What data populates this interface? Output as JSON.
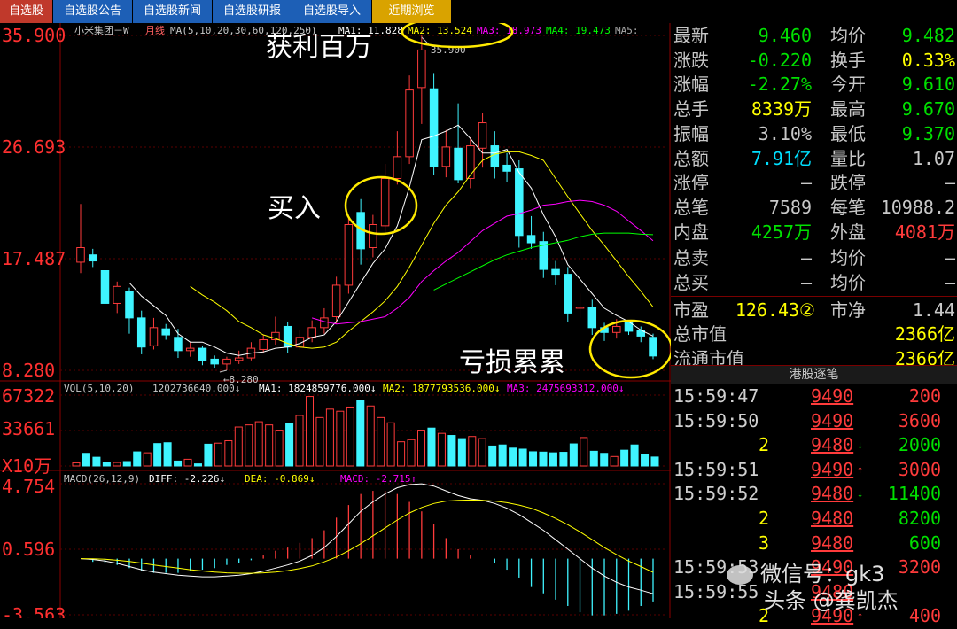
{
  "tabs": [
    "自选股",
    "自选股公告",
    "自选股新闻",
    "自选股研报",
    "自选股导入",
    "近期浏览"
  ],
  "chart_data": {
    "type": "candlestick",
    "title": "小米集团－W",
    "period": "月线",
    "ma_legend": "MA(5,10,20,30,60,120,250)",
    "ma_items": [
      {
        "text": "MA1: 11.828",
        "color": "#ffffff"
      },
      {
        "text": "MA2: 13.524",
        "color": "#ffff00"
      },
      {
        "text": "MA3: 18.973",
        "color": "#ff00ff"
      },
      {
        "text": "MA4: 19.473",
        "color": "#00ff00"
      },
      {
        "text": "MA5:",
        "color": "#aaaaaa"
      }
    ],
    "price_ticks": [
      "35.900",
      "26.693",
      "17.487",
      "8.280"
    ],
    "price_tick_values": [
      35.9,
      26.693,
      17.487,
      8.28
    ],
    "ylim": [
      8.28,
      35.9
    ],
    "high_label": "35.900",
    "low_label": "8.280",
    "candles": [
      {
        "o": 17.2,
        "h": 22.0,
        "l": 16.3,
        "c": 18.4
      },
      {
        "o": 17.8,
        "h": 18.3,
        "l": 16.8,
        "c": 17.3
      },
      {
        "o": 16.5,
        "h": 16.9,
        "l": 13.2,
        "c": 13.8
      },
      {
        "o": 13.8,
        "h": 15.6,
        "l": 13.0,
        "c": 15.2
      },
      {
        "o": 14.8,
        "h": 15.1,
        "l": 11.3,
        "c": 12.6
      },
      {
        "o": 12.6,
        "h": 13.2,
        "l": 9.6,
        "c": 10.2
      },
      {
        "o": 10.3,
        "h": 12.6,
        "l": 10.0,
        "c": 11.8
      },
      {
        "o": 11.7,
        "h": 12.1,
        "l": 10.8,
        "c": 11.2
      },
      {
        "o": 11.0,
        "h": 11.7,
        "l": 9.3,
        "c": 9.9
      },
      {
        "o": 9.9,
        "h": 10.6,
        "l": 9.4,
        "c": 10.1
      },
      {
        "o": 10.1,
        "h": 10.3,
        "l": 8.7,
        "c": 9.1
      },
      {
        "o": 9.2,
        "h": 9.5,
        "l": 8.5,
        "c": 8.8
      },
      {
        "o": 8.8,
        "h": 9.4,
        "l": 8.28,
        "c": 9.2
      },
      {
        "o": 9.1,
        "h": 9.9,
        "l": 8.8,
        "c": 9.3
      },
      {
        "o": 9.3,
        "h": 10.6,
        "l": 9.1,
        "c": 10.1
      },
      {
        "o": 10.0,
        "h": 11.2,
        "l": 9.7,
        "c": 10.8
      },
      {
        "o": 10.8,
        "h": 12.7,
        "l": 10.4,
        "c": 11.4
      },
      {
        "o": 11.9,
        "h": 12.3,
        "l": 9.7,
        "c": 10.2
      },
      {
        "o": 10.2,
        "h": 11.6,
        "l": 10.0,
        "c": 11.0
      },
      {
        "o": 11.0,
        "h": 12.4,
        "l": 10.6,
        "c": 11.8
      },
      {
        "o": 11.8,
        "h": 13.4,
        "l": 11.3,
        "c": 12.6
      },
      {
        "o": 12.7,
        "h": 16.0,
        "l": 12.1,
        "c": 15.3
      },
      {
        "o": 15.3,
        "h": 21.0,
        "l": 14.6,
        "c": 20.3
      },
      {
        "o": 21.3,
        "h": 22.4,
        "l": 17.0,
        "c": 18.3
      },
      {
        "o": 18.4,
        "h": 21.1,
        "l": 17.6,
        "c": 20.3
      },
      {
        "o": 20.2,
        "h": 25.3,
        "l": 19.7,
        "c": 24.1
      },
      {
        "o": 24.1,
        "h": 28.0,
        "l": 23.6,
        "c": 25.9
      },
      {
        "o": 25.9,
        "h": 32.6,
        "l": 25.3,
        "c": 31.4
      },
      {
        "o": 31.6,
        "h": 35.9,
        "l": 28.6,
        "c": 34.7
      },
      {
        "o": 31.5,
        "h": 32.8,
        "l": 24.4,
        "c": 25.1
      },
      {
        "o": 25.1,
        "h": 28.1,
        "l": 24.2,
        "c": 26.7
      },
      {
        "o": 26.6,
        "h": 30.3,
        "l": 23.7,
        "c": 24.0
      },
      {
        "o": 24.1,
        "h": 27.5,
        "l": 23.3,
        "c": 26.8
      },
      {
        "o": 26.6,
        "h": 29.5,
        "l": 25.0,
        "c": 28.7
      },
      {
        "o": 26.8,
        "h": 28.0,
        "l": 24.1,
        "c": 25.1
      },
      {
        "o": 25.2,
        "h": 26.2,
        "l": 23.8,
        "c": 24.7
      },
      {
        "o": 24.9,
        "h": 25.6,
        "l": 18.4,
        "c": 19.4
      },
      {
        "o": 19.4,
        "h": 21.0,
        "l": 18.3,
        "c": 18.8
      },
      {
        "o": 18.9,
        "h": 19.7,
        "l": 15.9,
        "c": 16.6
      },
      {
        "o": 16.6,
        "h": 17.3,
        "l": 15.3,
        "c": 16.2
      },
      {
        "o": 16.2,
        "h": 16.8,
        "l": 12.3,
        "c": 13.0
      },
      {
        "o": 13.4,
        "h": 14.6,
        "l": 12.6,
        "c": 13.5
      },
      {
        "o": 13.5,
        "h": 14.1,
        "l": 11.2,
        "c": 11.8
      },
      {
        "o": 11.8,
        "h": 12.2,
        "l": 10.7,
        "c": 11.4
      },
      {
        "o": 11.4,
        "h": 12.5,
        "l": 10.9,
        "c": 11.9
      },
      {
        "o": 12.2,
        "h": 12.4,
        "l": 11.2,
        "c": 11.5
      },
      {
        "o": 11.6,
        "h": 11.9,
        "l": 10.6,
        "c": 11.1
      },
      {
        "o": 11.0,
        "h": 11.3,
        "l": 9.2,
        "c": 9.46
      }
    ],
    "ma_lines": [
      {
        "name": "MA1",
        "color": "#ffffff",
        "values": [
          null,
          null,
          null,
          null,
          15.5,
          14.4,
          13.6,
          12.8,
          11.3,
          10.6,
          10.6,
          10.2,
          9.7,
          9.5,
          9.7,
          9.8,
          10.1,
          10.2,
          10.5,
          11.0,
          11.2,
          12.3,
          13.9,
          15.5,
          17.1,
          18.3,
          20.2,
          23.4,
          27.3,
          27.6,
          28.0,
          28.5,
          27.4,
          26.2,
          26.2,
          26.5,
          24.6,
          23.3,
          21.1,
          19.3,
          17.0,
          15.8,
          14.6,
          13.4,
          12.8,
          12.3,
          11.6,
          11.1
        ]
      },
      {
        "name": "MA2",
        "color": "#ffff00",
        "values": [
          null,
          null,
          null,
          null,
          null,
          null,
          null,
          null,
          null,
          15.2,
          14.5,
          13.9,
          13.2,
          12.3,
          11.8,
          11.2,
          10.9,
          10.5,
          10.2,
          10.1,
          10.2,
          10.6,
          11.5,
          12.3,
          13.1,
          14.0,
          15.2,
          16.8,
          18.6,
          20.4,
          21.9,
          23.0,
          24.4,
          25.6,
          26.1,
          26.3,
          26.3,
          26.0,
          25.6,
          24.1,
          22.6,
          21.2,
          19.8,
          18.6,
          17.3,
          16.0,
          14.8,
          13.5
        ]
      },
      {
        "name": "MA3",
        "color": "#ff00ff",
        "values": [
          null,
          null,
          null,
          null,
          null,
          null,
          null,
          null,
          null,
          null,
          null,
          null,
          null,
          null,
          null,
          null,
          null,
          null,
          null,
          12.6,
          12.3,
          12.1,
          12.2,
          12.3,
          12.5,
          12.7,
          13.4,
          14.3,
          15.6,
          16.5,
          17.3,
          18.0,
          18.9,
          19.8,
          20.4,
          21.0,
          21.2,
          21.5,
          21.9,
          22.0,
          22.2,
          22.3,
          22.2,
          21.9,
          21.4,
          20.6,
          19.8,
          18.97
        ]
      },
      {
        "name": "MA4",
        "color": "#00ff00",
        "values": [
          null,
          null,
          null,
          null,
          null,
          null,
          null,
          null,
          null,
          null,
          null,
          null,
          null,
          null,
          null,
          null,
          null,
          null,
          null,
          null,
          null,
          null,
          null,
          null,
          null,
          null,
          null,
          null,
          null,
          14.9,
          15.4,
          15.9,
          16.4,
          16.9,
          17.4,
          17.8,
          18.1,
          18.4,
          18.6,
          18.8,
          19.0,
          19.3,
          19.5,
          19.6,
          19.6,
          19.6,
          19.5,
          19.47
        ]
      }
    ],
    "volume": {
      "legend": "VOL(5,10,20)",
      "value_text": "1202736640.000↓",
      "items": [
        {
          "text": "MA1: 1824859776.000↓",
          "color": "#ffffff"
        },
        {
          "text": "MA2: 1877793536.000↓",
          "color": "#ffff00"
        },
        {
          "text": "MA3: 2475693312.000↓",
          "color": "#ff00ff"
        }
      ],
      "ticks": [
        "67322",
        "33661",
        "X10万"
      ],
      "tick_values": [
        67322,
        33661,
        0
      ],
      "ylim": [
        0,
        67322
      ],
      "values": [
        3000,
        12000,
        8300,
        3600,
        3300,
        4200,
        13400,
        12500,
        21300,
        22100,
        4700,
        6400,
        2000,
        20700,
        21700,
        24000,
        37000,
        39000,
        42000,
        39000,
        34000,
        40000,
        48000,
        66000,
        46000,
        54000,
        52000,
        56000,
        62000,
        57000,
        46000,
        41000,
        23000,
        25000,
        34000,
        36000,
        31000,
        29000,
        26000,
        28000,
        26000,
        19000,
        20000,
        17000,
        16000,
        13500,
        13200,
        12500,
        13000,
        21000,
        27000,
        14000,
        12000,
        9000,
        15000,
        20000,
        11000,
        8500
      ]
    },
    "macd": {
      "legend": "MACD(26,12,9)",
      "items": [
        {
          "text": "DIFF: -2.226↓",
          "color": "#ffffff"
        },
        {
          "text": "DEA: -0.869↓",
          "color": "#ffff00"
        },
        {
          "text": "MACD: -2.715↑",
          "color": "#ff00ff"
        }
      ],
      "ticks": [
        "4.754",
        "0.596",
        "-3.563"
      ],
      "tick_values": [
        4.754,
        0.596,
        -3.563
      ],
      "ylim": [
        -3.563,
        4.754
      ],
      "diff": [
        0,
        -0.05,
        -0.15,
        -0.3,
        -0.5,
        -0.7,
        -0.85,
        -0.95,
        -1.05,
        -1.1,
        -1.15,
        -1.15,
        -1.1,
        -1.05,
        -0.95,
        -0.8,
        -0.6,
        -0.4,
        -0.15,
        0.2,
        0.7,
        1.4,
        2.2,
        3.0,
        3.6,
        4.1,
        4.5,
        4.7,
        4.75,
        4.6,
        4.3,
        4.0,
        3.8,
        3.7,
        3.5,
        3.2,
        2.8,
        2.3,
        1.8,
        1.2,
        0.6,
        0.0,
        -0.6,
        -1.1,
        -1.5,
        -1.8,
        -2.0,
        -2.226
      ],
      "dea": [
        0,
        -0.01,
        -0.04,
        -0.1,
        -0.18,
        -0.28,
        -0.4,
        -0.5,
        -0.6,
        -0.7,
        -0.78,
        -0.85,
        -0.9,
        -0.92,
        -0.93,
        -0.9,
        -0.85,
        -0.76,
        -0.63,
        -0.46,
        -0.2,
        0.1,
        0.5,
        0.95,
        1.45,
        1.95,
        2.45,
        2.9,
        3.25,
        3.5,
        3.65,
        3.7,
        3.72,
        3.7,
        3.65,
        3.55,
        3.4,
        3.2,
        2.9,
        2.55,
        2.15,
        1.7,
        1.2,
        0.7,
        0.25,
        -0.15,
        -0.5,
        -0.869
      ],
      "hist": [
        0,
        -0.2,
        -0.3,
        -0.4,
        -0.6,
        -0.8,
        -0.9,
        -0.9,
        -0.9,
        -0.8,
        -0.7,
        -0.6,
        -0.4,
        -0.3,
        -0.1,
        0.2,
        0.5,
        0.7,
        1.0,
        1.3,
        1.8,
        2.6,
        3.4,
        4.1,
        4.3,
        4.3,
        4.1,
        3.6,
        3.0,
        2.2,
        1.3,
        0.6,
        0.2,
        0.0,
        -0.3,
        -0.7,
        -1.2,
        -1.8,
        -2.2,
        -2.6,
        -3.0,
        -3.4,
        -3.6,
        -3.6,
        -3.5,
        -3.3,
        -3.0,
        -2.715
      ]
    }
  },
  "annotations": {
    "profit": "获利百万",
    "buy": "买入",
    "loss": "亏损累累"
  },
  "quote": {
    "rows": [
      {
        "l1": "最新",
        "v1": "9.460",
        "c1": "#00e000",
        "l2": "均价",
        "v2": "9.482",
        "c2": "#00e000"
      },
      {
        "l1": "涨跌",
        "v1": "-0.220",
        "c1": "#00e000",
        "l2": "换手",
        "v2": "0.33%",
        "c2": "#ffff00"
      },
      {
        "l1": "涨幅",
        "v1": "-2.27%",
        "c1": "#00e000",
        "l2": "今开",
        "v2": "9.610",
        "c2": "#00e000"
      },
      {
        "l1": "总手",
        "v1": "8339万",
        "c1": "#ffff00",
        "l2": "最高",
        "v2": "9.670",
        "c2": "#00e000"
      },
      {
        "l1": "振幅",
        "v1": "3.10%",
        "c1": "#c8c8c8",
        "l2": "最低",
        "v2": "9.370",
        "c2": "#00e000"
      },
      {
        "l1": "总额",
        "v1": "7.91亿",
        "c1": "#00e0ff",
        "l2": "量比",
        "v2": "1.07",
        "c2": "#c8c8c8"
      },
      {
        "l1": "涨停",
        "v1": "–",
        "c1": "#c8c8c8",
        "l2": "跌停",
        "v2": "–",
        "c2": "#c8c8c8"
      },
      {
        "l1": "总笔",
        "v1": "7589",
        "c1": "#c8c8c8",
        "l2": "每笔",
        "v2": "10988.2",
        "c2": "#c8c8c8"
      },
      {
        "l1": "内盘",
        "v1": "4257万",
        "c1": "#00e000",
        "l2": "外盘",
        "v2": "4081万",
        "c2": "#ff3b3b"
      }
    ],
    "sell_rows": [
      {
        "l1": "总卖",
        "v1": "–",
        "l2": "均价",
        "v2": "–"
      },
      {
        "l1": "总买",
        "v1": "–",
        "l2": "均价",
        "v2": "–"
      }
    ],
    "pe_label": "市盈",
    "pe_value": "126.43②",
    "pb_label": "市净",
    "pb_value": "1.44",
    "mcap_label": "总市值",
    "mcap_value": "2366亿",
    "float_label": "流通市值",
    "float_value": "2366亿"
  },
  "trades": {
    "header": "港股逐笔",
    "rows": [
      {
        "time": "15:59:47",
        "price": "9490",
        "arrow": "",
        "vol": "200",
        "vc": "#ff3b3b"
      },
      {
        "time": "15:59:50",
        "price": "9490",
        "arrow": "",
        "vol": "3600",
        "vc": "#ff3b3b"
      },
      {
        "time": "2",
        "price": "9480",
        "arrow": "↓",
        "vol": "2000",
        "vc": "#00e000"
      },
      {
        "time": "15:59:51",
        "price": "9490",
        "arrow": "↑",
        "vol": "3000",
        "vc": "#ff3b3b"
      },
      {
        "time": "15:59:52",
        "price": "9480",
        "arrow": "↓",
        "vol": "11400",
        "vc": "#00e000"
      },
      {
        "time": "2",
        "price": "9480",
        "arrow": "",
        "vol": "8200",
        "vc": "#00e000"
      },
      {
        "time": "3",
        "price": "9480",
        "arrow": "",
        "vol": "600",
        "vc": "#00e000"
      },
      {
        "time": "15:59:53",
        "price": "9490",
        "arrow": "",
        "vol": "3200",
        "vc": "#ff3b3b"
      },
      {
        "time": "15:59:55",
        "price": "9480",
        "arrow": "",
        "vol": "",
        "vc": "#00e000"
      },
      {
        "time": "2",
        "price": "9490",
        "arrow": "↑",
        "vol": "400",
        "vc": "#ff3b3b"
      }
    ]
  },
  "watermark": {
    "platform": "微信号：gk3",
    "author": "头条 @龚凯杰"
  }
}
